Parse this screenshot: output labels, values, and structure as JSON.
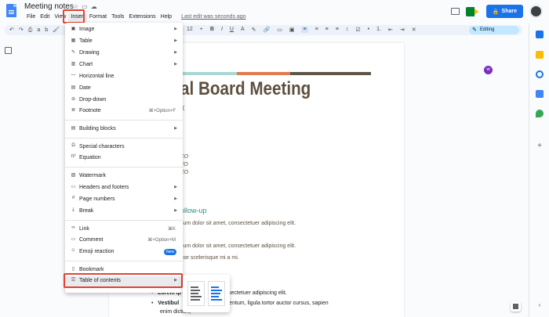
{
  "app": {
    "doc_title": "Meeting notes",
    "last_edit": "Last edit was seconds ago",
    "share_label": "Share",
    "mode_label": "Editing",
    "font_size": "12"
  },
  "menubar": [
    "File",
    "Edit",
    "View",
    "Insert",
    "Format",
    "Tools",
    "Extensions",
    "Help"
  ],
  "insert_menu": {
    "items": [
      {
        "icon": "image-icon",
        "label": "Image",
        "submenu": true
      },
      {
        "icon": "table-icon",
        "label": "Table",
        "submenu": true
      },
      {
        "icon": "drawing-icon",
        "label": "Drawing",
        "submenu": true
      },
      {
        "icon": "chart-icon",
        "label": "Chart",
        "submenu": true
      },
      {
        "icon": "horizontal-line-icon",
        "label": "Horizontal line"
      },
      {
        "icon": "date-icon",
        "label": "Date"
      },
      {
        "icon": "dropdown-icon",
        "label": "Drop-down"
      },
      {
        "icon": "footnote-icon",
        "label": "Footnote",
        "shortcut": "⌘+Option+F"
      },
      {
        "icon": "building-blocks-icon",
        "label": "Building blocks",
        "submenu": true
      },
      {
        "icon": "omega-icon",
        "label": "Special characters"
      },
      {
        "icon": "equation-icon",
        "label": "Equation"
      },
      {
        "icon": "watermark-icon",
        "label": "Watermark"
      },
      {
        "icon": "headers-footers-icon",
        "label": "Headers and footers",
        "submenu": true
      },
      {
        "icon": "page-numbers-icon",
        "label": "Page numbers",
        "submenu": true
      },
      {
        "icon": "break-icon",
        "label": "Break",
        "submenu": true
      },
      {
        "icon": "link-icon",
        "label": "Link",
        "shortcut": "⌘K"
      },
      {
        "icon": "comment-icon",
        "label": "Comment",
        "shortcut": "⌘+Option+M"
      },
      {
        "icon": "emoji-icon",
        "label": "Emoji reaction",
        "badge": "New"
      },
      {
        "icon": "bookmark-icon",
        "label": "Bookmark"
      },
      {
        "icon": "toc-icon",
        "label": "Table of contents",
        "submenu": true
      }
    ]
  },
  "document": {
    "title_fragment": "al Board Meeting",
    "subtitle_fragment": "X",
    "names": [
      "EO",
      "FO",
      "EO"
    ],
    "section_heading": "ollow-up",
    "paragraphs": [
      "sum dolor sit amet, consectetuer adipiscing elit.",
      "sum dolor sit amet, consectetuer adipiscing elit.",
      "sse scelerisque mi a mi."
    ],
    "bullets": [
      {
        "bold": "Lorem ip",
        "rest": "et, consectetuer adipiscing elit."
      },
      {
        "bold": "Vestibul",
        "rest": "is elementum, ligula tortor auctor cursus, sapien"
      }
    ],
    "bullet_tail": "enim dictum,"
  },
  "colors": {
    "accent": "#1a73e8",
    "highlight": "#e34234",
    "heading_brown": "#5e5040",
    "teal": "#2d8f82"
  }
}
